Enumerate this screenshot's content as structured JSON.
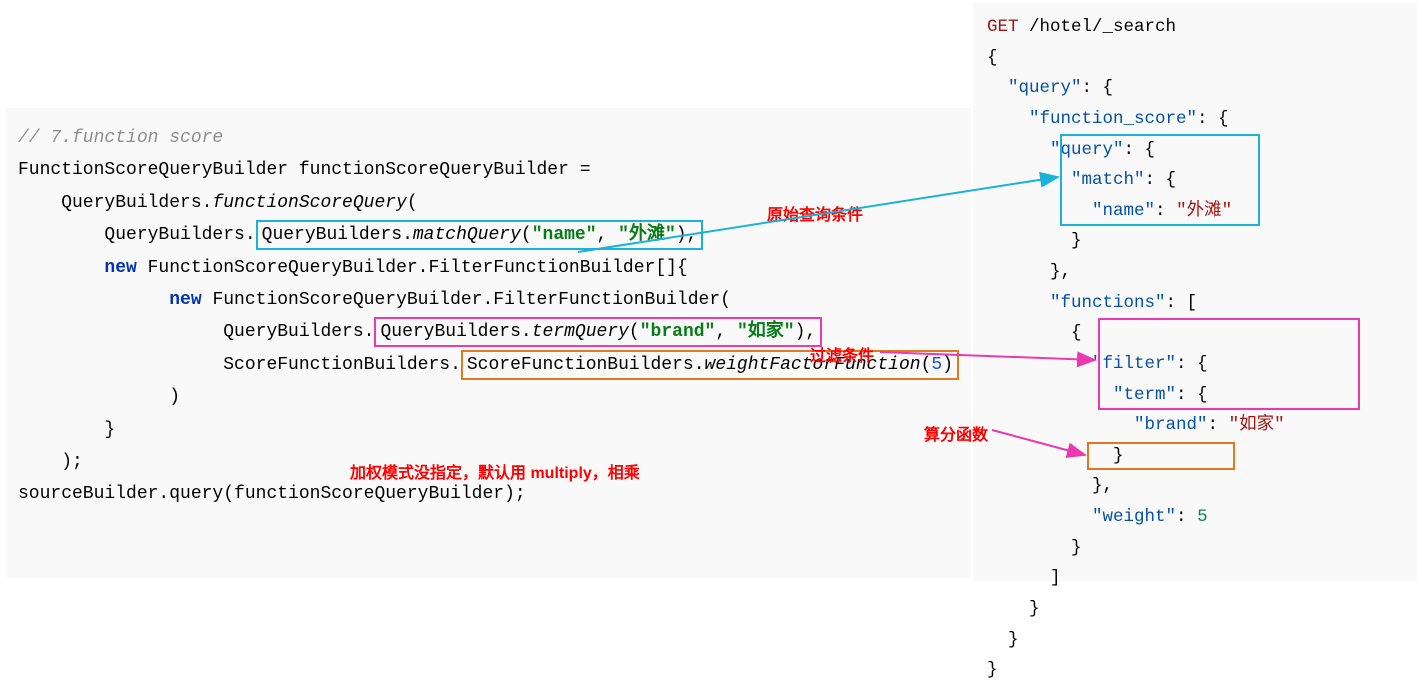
{
  "left": {
    "comment": "// 7.function score",
    "line2a": "FunctionScoreQueryBuilder functionScoreQueryBuilder =",
    "line3a": "    QueryBuilders.",
    "line3b": "functionScoreQuery",
    "line3c": "(",
    "line4a": "        QueryBuilders.",
    "line4b": "matchQuery",
    "line4c": "(",
    "line4s1": "\"name\"",
    "line4comma": ", ",
    "line4s2": "\"外滩\"",
    "line4end": "),",
    "line5a": "        ",
    "line5kw": "new",
    "line5b": " FunctionScoreQueryBuilder.FilterFunctionBuilder[]{",
    "line6a": "              ",
    "line6kw": "new",
    "line6b": " FunctionScoreQueryBuilder.FilterFunctionBuilder(",
    "line7a": "                   QueryBuilders.",
    "line7b": "termQuery",
    "line7c": "(",
    "line7s1": "\"brand\"",
    "line7comma": ", ",
    "line7s2": "\"如家\"",
    "line7end": "),",
    "line8a": "                   ScoreFunctionBuilders.",
    "line8b": "weightFactorFunction",
    "line8c": "(",
    "line8n": "5",
    "line8end": ")",
    "line9": "              )",
    "line10": "        }",
    "line11": "    );",
    "line12": "sourceBuilder.query(functionScoreQueryBuilder);"
  },
  "right": {
    "l1a": "GET",
    "l1b": " /hotel/_search",
    "l2": "{",
    "l3a": "  ",
    "l3k": "\"query\"",
    "l3b": ": {",
    "l4a": "    ",
    "l4k": "\"function_score\"",
    "l4b": ": {",
    "l5a": "      ",
    "l5k": "\"query\"",
    "l5b": ": {",
    "l6a": "        ",
    "l6k": "\"match\"",
    "l6b": ": {",
    "l7a": "          ",
    "l7k": "\"name\"",
    "l7b": ": ",
    "l7v": "\"外滩\"",
    "l8": "        }",
    "l9": "      },",
    "l10a": "      ",
    "l10k": "\"functions\"",
    "l10b": ": [",
    "l11": "        {",
    "l12a": "          ",
    "l12k": "\"filter\"",
    "l12b": ": {",
    "l13a": "            ",
    "l13k": "\"term\"",
    "l13b": ": {",
    "l14a": "              ",
    "l14k": "\"brand\"",
    "l14b": ": ",
    "l14v": "\"如家\"",
    "l15": "            }",
    "l16": "          },",
    "l17a": "          ",
    "l17k": "\"weight\"",
    "l17b": ": ",
    "l17v": "5",
    "l18": "        }",
    "l19": "      ]",
    "l20": "    }",
    "l21": "  }",
    "l22": "}"
  },
  "labels": {
    "label1": "原始查询条件",
    "label2": "过滤条件",
    "label3": "算分函数",
    "label4": "加权模式没指定，默认用 multiply，相乘"
  }
}
